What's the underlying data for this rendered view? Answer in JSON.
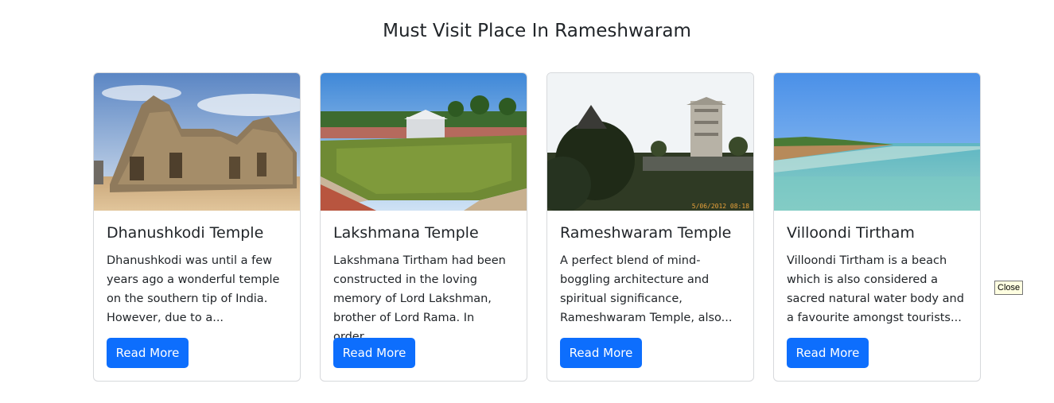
{
  "section": {
    "title": "Must Visit Place In Rameshwaram"
  },
  "cards": [
    {
      "title": "Dhanushkodi Temple",
      "text": "Dhanushkodi was until a few years ago a wonderful temple on the southern tip of India. However, due to a...",
      "button": "Read More"
    },
    {
      "title": "Lakshmana Temple",
      "text": "Lakshmana Tirtham had been constructed in the loving memory of Lord Lakshman, brother of Lord Rama. In order...",
      "button": "Read More"
    },
    {
      "title": "Rameshwaram Temple",
      "text": "A perfect blend of mind-boggling architecture and spiritual significance, Rameshwaram Temple, also...",
      "button": "Read More",
      "photo_stamp": "5/06/2012 08:18"
    },
    {
      "title": "Villoondi Tirtham",
      "text": "Villoondi Tirtham is a beach which is also considered a sacred natural water body and a favourite amongst tourists...",
      "button": "Read More"
    }
  ],
  "tooltip": {
    "text": "Close"
  },
  "colors": {
    "primary_button": "#0d6efd",
    "card_border": "#d7d9dc",
    "text": "#212529"
  }
}
